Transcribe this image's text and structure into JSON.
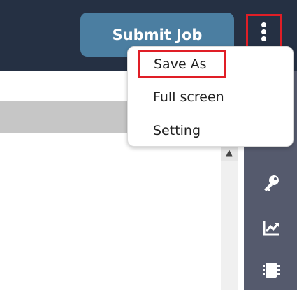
{
  "header": {
    "submit_label": "Submit Job"
  },
  "menu": {
    "items": [
      {
        "label": "Save As"
      },
      {
        "label": "Full screen"
      },
      {
        "label": "Setting"
      }
    ]
  },
  "icons": {
    "more": "vertical-dots-icon",
    "key": "key-icon",
    "chart": "trending-chart-icon",
    "chip": "chip-icon"
  },
  "colors": {
    "topbar": "#253043",
    "submit_button": "#4b7ea1",
    "highlight_border": "#e01e26",
    "right_rail": "#555a6d"
  }
}
